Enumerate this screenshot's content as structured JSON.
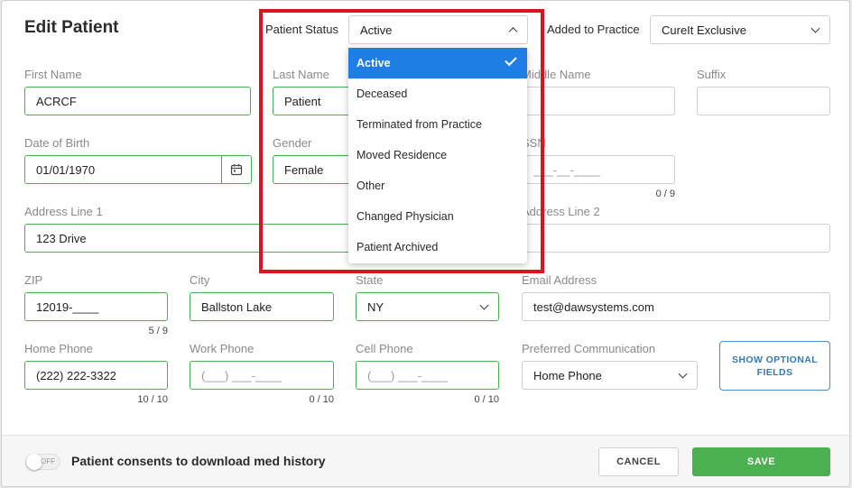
{
  "modal": {
    "title": "Edit Patient"
  },
  "header": {
    "patient_status_label": "Patient Status",
    "patient_status_value": "Active",
    "added_label": "Added to Practice",
    "added_value": "CureIt Exclusive"
  },
  "status_options": [
    "Active",
    "Deceased",
    "Terminated from Practice",
    "Moved Residence",
    "Other",
    "Changed Physician",
    "Patient Archived"
  ],
  "form": {
    "first_name": {
      "label": "First Name",
      "value": "ACRCF"
    },
    "last_name": {
      "label": "Last Name",
      "value": "Patient"
    },
    "middle_name": {
      "label": "Middle Name",
      "value": ""
    },
    "suffix": {
      "label": "Suffix",
      "value": ""
    },
    "dob": {
      "label": "Date of Birth",
      "value": "01/01/1970"
    },
    "gender": {
      "label": "Gender",
      "value": "Female"
    },
    "ssn": {
      "label": "SSN",
      "placeholder": "___-__-____",
      "counter": "0 / 9"
    },
    "address1": {
      "label": "Address Line 1",
      "value": "123 Drive"
    },
    "address2": {
      "label": "Address Line 2",
      "value": ""
    },
    "zip": {
      "label": "ZIP",
      "value": "12019-____",
      "counter": "5 / 9"
    },
    "city": {
      "label": "City",
      "value": "Ballston Lake"
    },
    "state": {
      "label": "State",
      "value": "NY"
    },
    "email": {
      "label": "Email Address",
      "value": "test@dawsystems.com"
    },
    "home_phone": {
      "label": "Home Phone",
      "value": "(222) 222-3322",
      "counter": "10 / 10"
    },
    "work_phone": {
      "label": "Work Phone",
      "placeholder": "(___) ___-____",
      "counter": "0 / 10"
    },
    "cell_phone": {
      "label": "Cell Phone",
      "placeholder": "(___) ___-____",
      "counter": "0 / 10"
    },
    "preferred": {
      "label": "Preferred Communication",
      "value": "Home Phone"
    },
    "optional_button": "SHOW OPTIONAL FIELDS"
  },
  "footer": {
    "toggle_text": "OFF",
    "consent_label": "Patient consents to download med history",
    "cancel_label": "CANCEL",
    "save_label": "SAVE"
  },
  "colors": {
    "accent": "#4caf50",
    "selected": "#1f7de6",
    "highlight": "#d9141c",
    "link": "#3478b8"
  }
}
